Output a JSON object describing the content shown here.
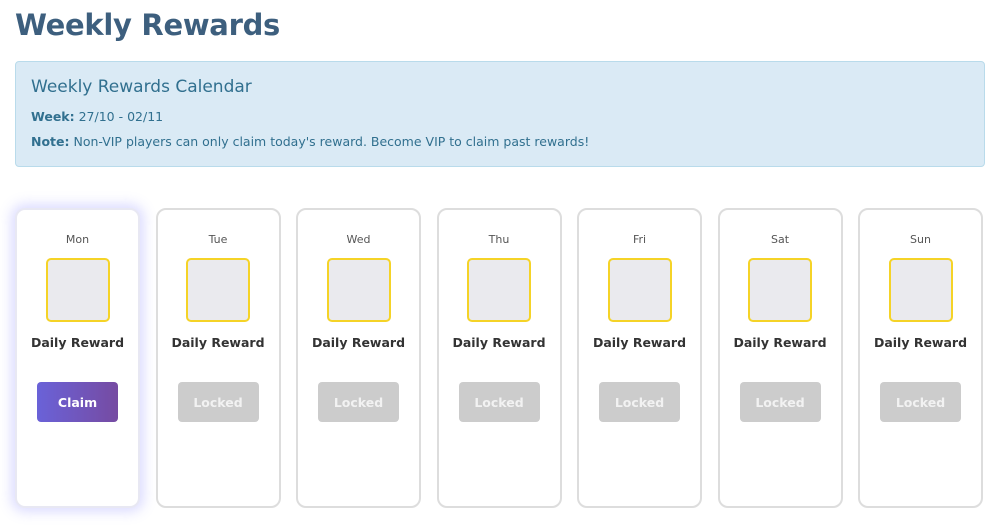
{
  "page": {
    "title": "Weekly Rewards"
  },
  "info": {
    "title": "Weekly Rewards Calendar",
    "week_label": "Week:",
    "week_value": "27/10 - 02/11",
    "note_label": "Note:",
    "note_value": "Non-VIP players can only claim today's reward. Become VIP to claim past rewards!"
  },
  "days": [
    {
      "day": "Mon",
      "reward": "Daily Reward",
      "button": "Claim",
      "state": "claim"
    },
    {
      "day": "Tue",
      "reward": "Daily Reward",
      "button": "Locked",
      "state": "locked"
    },
    {
      "day": "Wed",
      "reward": "Daily Reward",
      "button": "Locked",
      "state": "locked"
    },
    {
      "day": "Thu",
      "reward": "Daily Reward",
      "button": "Locked",
      "state": "locked"
    },
    {
      "day": "Fri",
      "reward": "Daily Reward",
      "button": "Locked",
      "state": "locked"
    },
    {
      "day": "Sat",
      "reward": "Daily Reward",
      "button": "Locked",
      "state": "locked"
    },
    {
      "day": "Sun",
      "reward": "Daily Reward",
      "button": "Locked",
      "state": "locked"
    }
  ],
  "colors": {
    "title": "#3d5f7e",
    "info_bg": "#daeaf5",
    "info_text": "#31708f",
    "reward_border": "#f5d327",
    "claim_gradient_start": "#6a62d8",
    "claim_gradient_end": "#764ba2",
    "locked": "#cccccc"
  }
}
